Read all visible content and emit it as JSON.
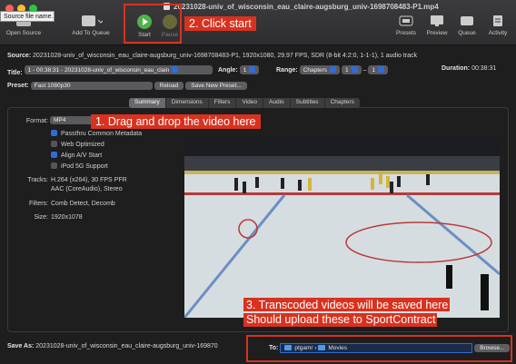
{
  "window": {
    "title": "20231028-univ_of_wisconsin_eau_claire-augsburg_univ-1698708483-P1.mp4"
  },
  "tooltip": "Source file name.",
  "toolbar": {
    "open_source": "Open Source",
    "add_to_queue": "Add To Queue",
    "start": "Start",
    "pause": "Pause",
    "presets": "Presets",
    "preview": "Preview",
    "queue": "Queue",
    "activity": "Activity"
  },
  "annotations": {
    "click_start": "2. Click start",
    "drag_drop": "1. Drag and drop the video here",
    "transcoded_line1": "3. Transcoded videos will be saved here",
    "transcoded_line2": "Should upload these to SportContract",
    "color": "#d8321f"
  },
  "source": {
    "label": "Source:",
    "value": "20231028-univ_of_wisconsin_eau_claire-augsburg_univ-1698708483-P1, 1920x1080, 29.97 FPS, SDR (8-bit 4:2:0, 1-1-1), 1 audio track"
  },
  "title_row": {
    "title_label": "Title:",
    "title_value": "1 - 00:38:31 - 20231028-univ_of_wisconsin_eau_clain",
    "angle_label": "Angle:",
    "angle_value": "1",
    "range_label": "Range:",
    "range_type": "Chapters",
    "range_from": "1",
    "range_dash": "–",
    "range_to": "1",
    "duration_label": "Duration:",
    "duration_value": "00:38:31"
  },
  "preset_row": {
    "label": "Preset:",
    "value": "Fast 1080p30",
    "reload": "Reload",
    "save_new": "Save New Preset..."
  },
  "tabs": [
    "Summary",
    "Dimensions",
    "Filters",
    "Video",
    "Audio",
    "Subtitles",
    "Chapters"
  ],
  "summary": {
    "format_label": "Format:",
    "format_value": "MP4",
    "passthru": "Passthru Common Metadata",
    "web_optimized": "Web Optimized",
    "align_av": "Align A/V Start",
    "ipod": "iPod 5G Support",
    "tracks_label": "Tracks:",
    "tracks_line1": "H.264 (x264), 30 FPS PFR",
    "tracks_line2": "AAC (CoreAudio), Stereo",
    "filters_label": "Filters:",
    "filters_value": "Comb Detect, Decomb",
    "size_label": "Size:",
    "size_value": "1920x1078"
  },
  "save": {
    "label": "Save As:",
    "value": "20231028-univ_of_wisconsin_eau_claire-augsburg_univ-169870",
    "to_label": "To:",
    "path_user": "ptgamr",
    "path_sep": "›",
    "path_folder": "Movies",
    "browse": "Browse..."
  }
}
